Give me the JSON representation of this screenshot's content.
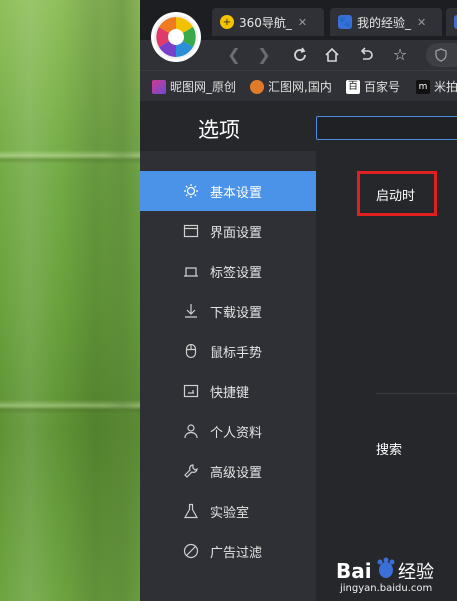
{
  "tabs": [
    {
      "label": "360导航_",
      "icon": "plus-circle-icon"
    },
    {
      "label": "我的经验_",
      "icon": "paw-icon"
    }
  ],
  "bookmarks": [
    {
      "label": "昵图网_原创",
      "icon": "nipic-icon"
    },
    {
      "label": "汇图网,国内",
      "icon": "huitu-icon"
    },
    {
      "label": "百家号",
      "icon": "baijiahao-icon"
    },
    {
      "label": "米拍",
      "icon": "mipai-icon"
    }
  ],
  "settings": {
    "title": "选项",
    "search_value": ""
  },
  "sidebar": {
    "items": [
      {
        "label": "基本设置",
        "icon": "gear-sun-icon",
        "active": true
      },
      {
        "label": "界面设置",
        "icon": "window-icon",
        "active": false
      },
      {
        "label": "标签设置",
        "icon": "tab-icon",
        "active": false
      },
      {
        "label": "下载设置",
        "icon": "download-icon",
        "active": false
      },
      {
        "label": "鼠标手势",
        "icon": "mouse-icon",
        "active": false
      },
      {
        "label": "快捷键",
        "icon": "keyboard-icon",
        "active": false
      },
      {
        "label": "个人资料",
        "icon": "user-icon",
        "active": false
      },
      {
        "label": "高级设置",
        "icon": "wrench-icon",
        "active": false
      },
      {
        "label": "实验室",
        "icon": "flask-icon",
        "active": false
      },
      {
        "label": "广告过滤",
        "icon": "block-icon",
        "active": false
      }
    ]
  },
  "content": {
    "startup_label": "启动时",
    "search_label": "搜索"
  },
  "watermark": {
    "site": "jingyan.baidu.com"
  },
  "colors": {
    "accent": "#4b93e8",
    "highlight_box": "#e02020"
  }
}
